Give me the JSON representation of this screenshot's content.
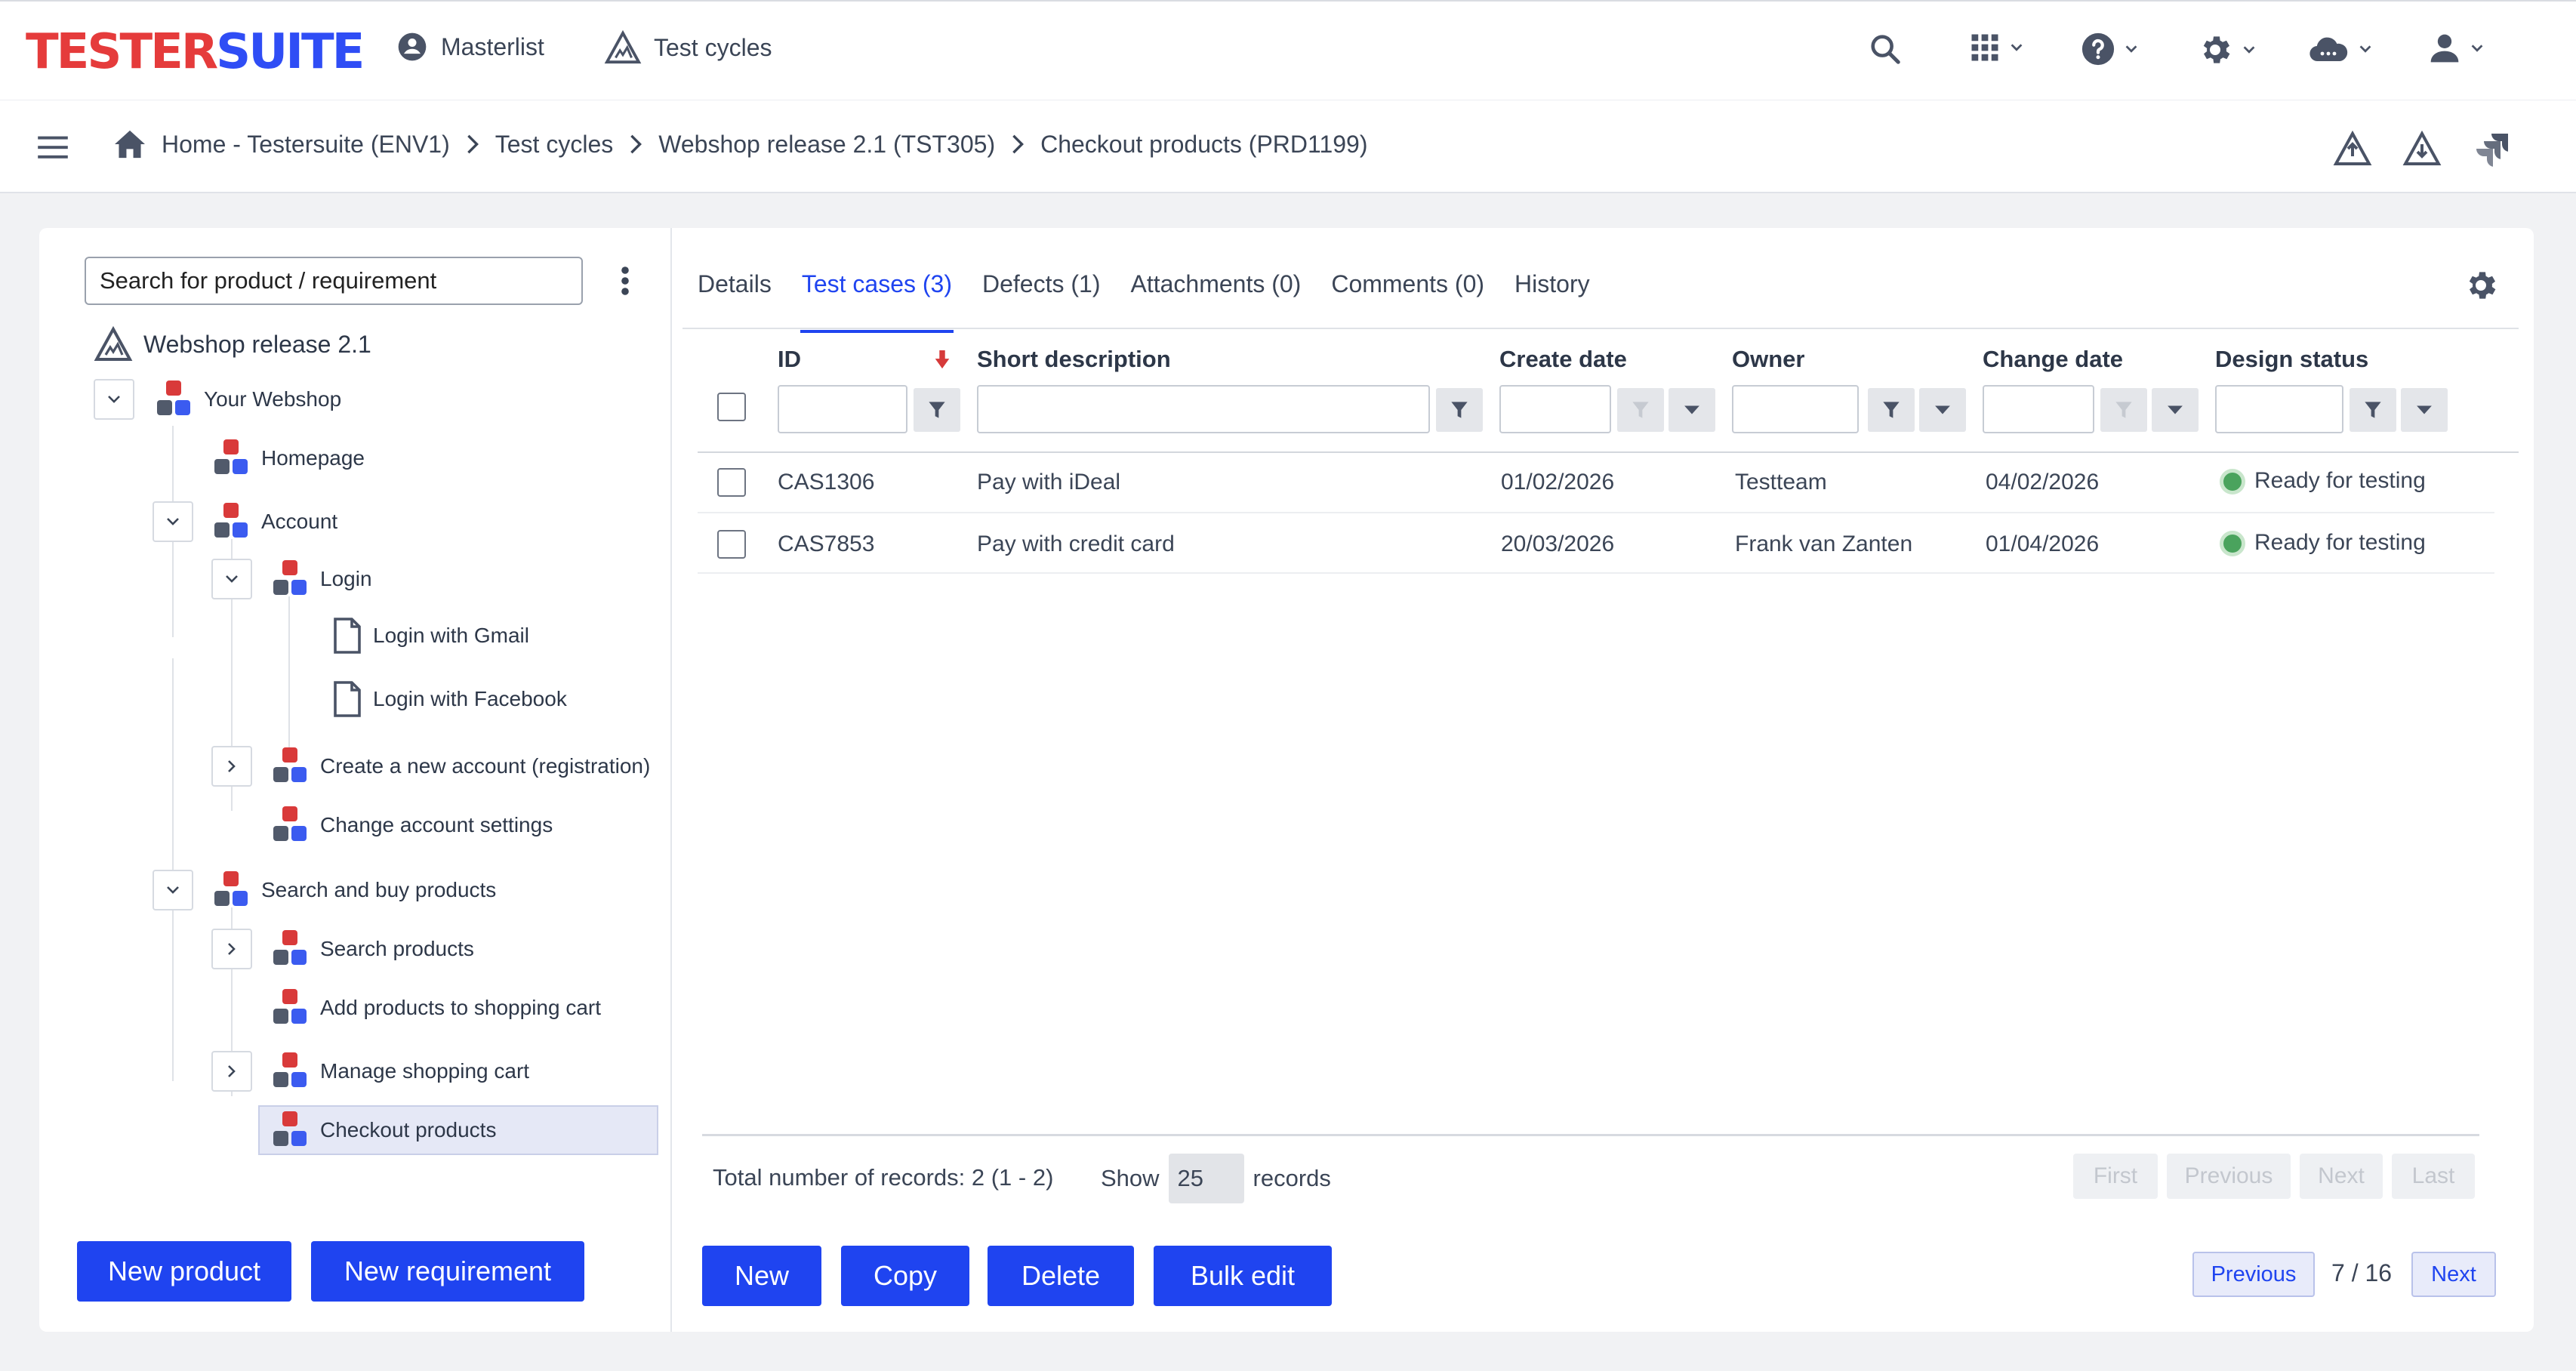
{
  "app": {
    "logo_part1": "TESTER",
    "logo_part2": "SUITE"
  },
  "topnav": {
    "masterlist": "Masterlist",
    "test_cycles": "Test cycles"
  },
  "breadcrumb": {
    "home": "Home - Testersuite (ENV1)",
    "items": [
      "Test cycles",
      "Webshop release 2.1 (TST305)",
      "Checkout products (PRD1199)"
    ]
  },
  "left": {
    "search_placeholder": "Search for product / requirement",
    "root": "Webshop release 2.1",
    "tree": [
      "Your Webshop",
      "Homepage",
      "Account",
      "Login",
      "Login with Gmail",
      "Login with Facebook",
      "Create a new account (registration)",
      "Change account settings",
      "Search and buy products",
      "Search products",
      "Add products to shopping cart",
      "Manage shopping cart",
      "Checkout products"
    ],
    "new_product": "New product",
    "new_requirement": "New requirement"
  },
  "tabs": [
    "Details",
    "Test cases (3)",
    "Defects (1)",
    "Attachments (0)",
    "Comments (0)",
    "History"
  ],
  "table": {
    "columns": [
      "ID",
      "Short description",
      "Create date",
      "Owner",
      "Change date",
      "Design status"
    ],
    "rows": [
      {
        "id": "CAS1306",
        "desc": "Pay with iDeal",
        "created": "01/02/2026",
        "owner": "Testteam",
        "changed": "04/02/2026",
        "status": "Ready for testing"
      },
      {
        "id": "CAS7853",
        "desc": "Pay with credit card",
        "created": "20/03/2026",
        "owner": "Frank van Zanten",
        "changed": "01/04/2026",
        "status": "Ready for testing"
      }
    ]
  },
  "footer": {
    "total": "Total number of records: 2 (1 - 2)",
    "show": "Show",
    "page_size": "25",
    "records": "records",
    "first": "First",
    "previous": "Previous",
    "next": "Next",
    "last": "Last"
  },
  "actions": {
    "new": "New",
    "copy": "Copy",
    "delete": "Delete",
    "bulk_edit": "Bulk edit",
    "prev_record": "Previous",
    "position": "7 / 16",
    "next_record": "Next"
  },
  "colors": {
    "brand_red": "#e53b3b",
    "brand_blue": "#2f4df5",
    "primary": "#1f44f0",
    "status_green": "#4aa35d"
  }
}
